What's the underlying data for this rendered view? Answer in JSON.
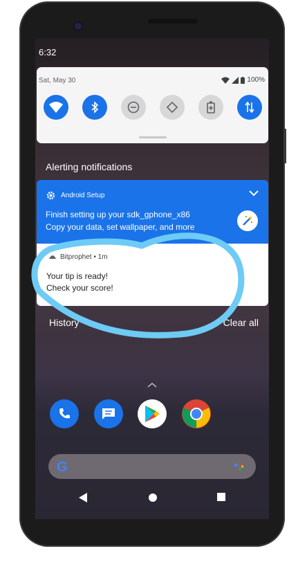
{
  "status_bar": {
    "time": "6:32"
  },
  "quick_settings": {
    "date": "Sat, May 30",
    "battery": "100%",
    "tiles": [
      {
        "name": "wifi",
        "state": "on"
      },
      {
        "name": "bluetooth",
        "state": "on"
      },
      {
        "name": "do-not-disturb",
        "state": "off"
      },
      {
        "name": "auto-rotate",
        "state": "off"
      },
      {
        "name": "battery-saver",
        "state": "off"
      },
      {
        "name": "mobile-data",
        "state": "on"
      }
    ]
  },
  "section_title": "Alerting notifications",
  "notifications": [
    {
      "app": "Android Setup",
      "title": "Finish setting up your sdk_gphone_x86",
      "text": "Copy your data, set wallpaper, and more"
    },
    {
      "app": "Bitprophet • 1m",
      "line1": "Your tip is ready!",
      "line2": "Check your score!"
    }
  ],
  "footer": {
    "history": "History",
    "clear_all": "Clear all"
  },
  "colors": {
    "accent": "#1a73e8",
    "annotation": "#6ecbf5"
  },
  "dock": [
    "phone-icon",
    "messages-icon",
    "play-store-icon",
    "chrome-icon"
  ],
  "navbar": [
    "back-button",
    "home-button",
    "recents-button"
  ]
}
